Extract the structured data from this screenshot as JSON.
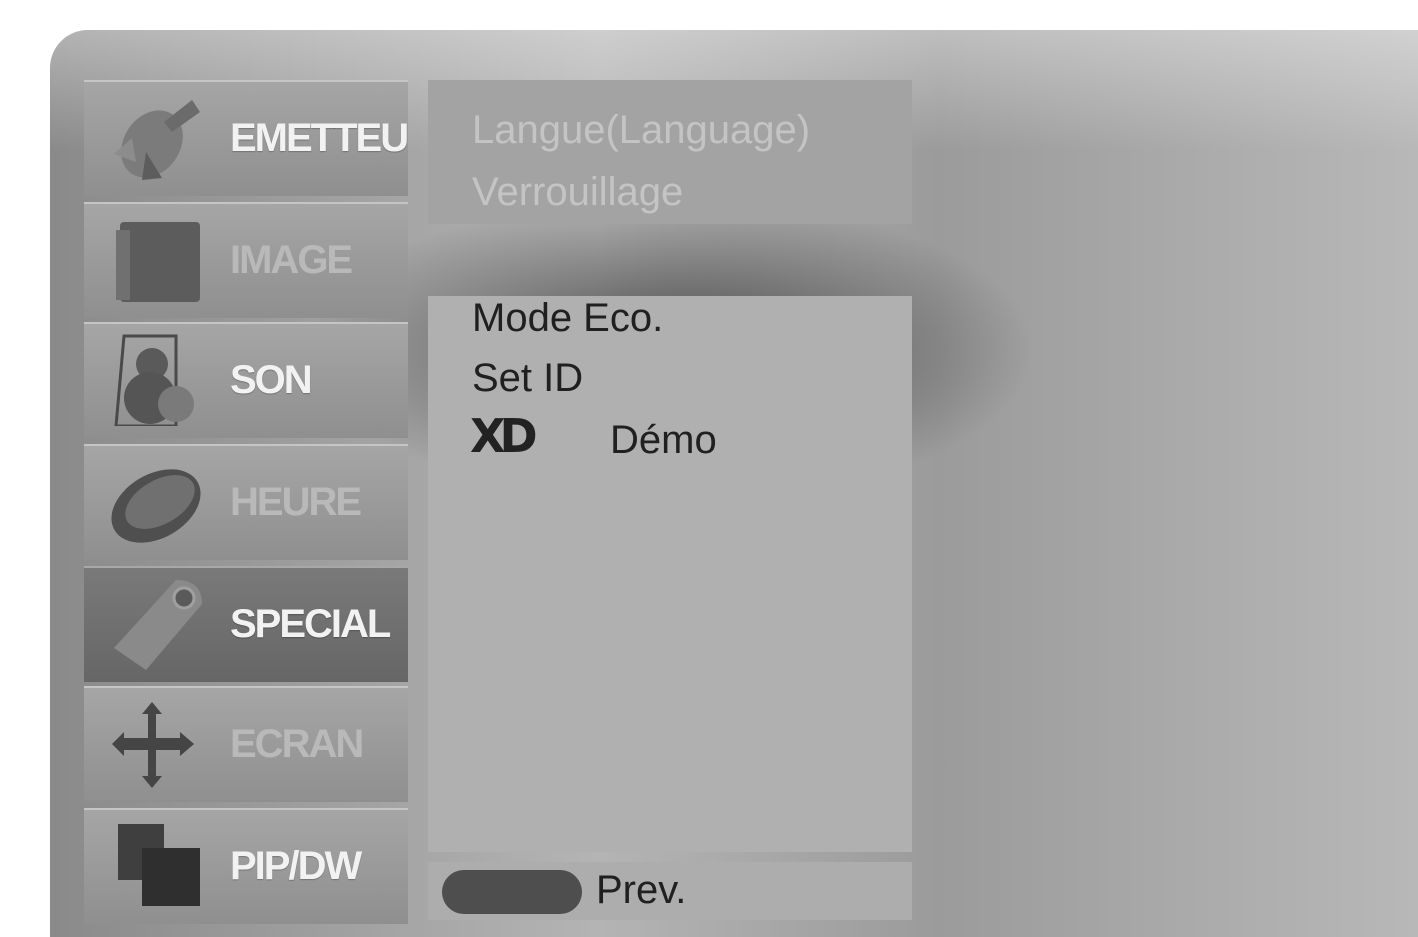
{
  "menu": {
    "items": [
      {
        "label": "EMETTEUR",
        "icon": "satellite-dish-icon",
        "state": "normal"
      },
      {
        "label": "IMAGE",
        "icon": "picture-icon",
        "state": "dim"
      },
      {
        "label": "SON",
        "icon": "speaker-icon",
        "state": "normal"
      },
      {
        "label": "HEURE",
        "icon": "clock-icon",
        "state": "dim"
      },
      {
        "label": "SPECIAL",
        "icon": "tag-icon",
        "state": "selected"
      },
      {
        "label": "ECRAN",
        "icon": "move-arrows-icon",
        "state": "dim"
      },
      {
        "label": "PIP/DW",
        "icon": "pip-screens-icon",
        "state": "normal"
      }
    ]
  },
  "top_panel": {
    "options": [
      "Langue(Language)",
      "Verrouillage"
    ]
  },
  "main_panel": {
    "options": [
      "Mode Eco.",
      "Set ID",
      "Démo"
    ],
    "xd_logo": "XD"
  },
  "bottom_bar": {
    "prev_label": "Prev."
  },
  "colors": {
    "panel": "#b0b0b0",
    "selected_item": "#6e6e6e",
    "text_dark": "#202020",
    "text_light": "#f2f2f2"
  }
}
